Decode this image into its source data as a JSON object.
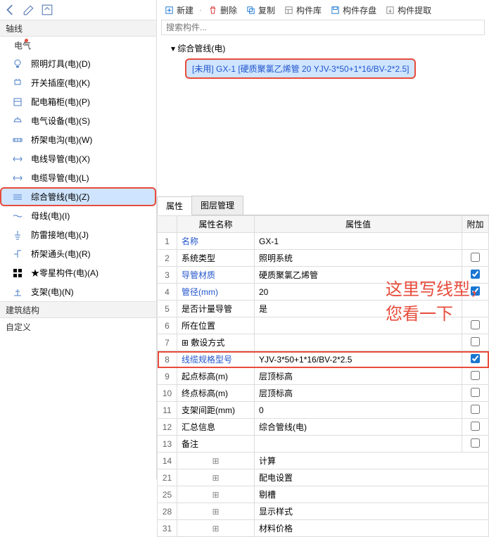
{
  "left": {
    "hdr1": "轴线",
    "cat": "电气",
    "items": [
      {
        "ic": "bulb",
        "t": "照明灯具(电)(D)"
      },
      {
        "ic": "plug",
        "t": "开关插座(电)(K)"
      },
      {
        "ic": "box",
        "t": "配电箱柜(电)(P)"
      },
      {
        "ic": "dev",
        "t": "电气设备(电)(S)"
      },
      {
        "ic": "tray",
        "t": "桥架电沟(电)(W)"
      },
      {
        "ic": "pipe",
        "t": "电线导管(电)(X)"
      },
      {
        "ic": "pipe",
        "t": "电缆导管(电)(L)"
      },
      {
        "ic": "net",
        "t": "综合管线(电)(Z)",
        "sel": true
      },
      {
        "ic": "bus",
        "t": "母线(电)(I)"
      },
      {
        "ic": "gnd",
        "t": "防雷接地(电)(J)"
      },
      {
        "ic": "el",
        "t": "桥架通头(电)(R)"
      },
      {
        "ic": "star",
        "t": "★零星构件(电)(A)"
      },
      {
        "ic": "sup",
        "t": "支架(电)(N)"
      }
    ],
    "hdr2": "建筑结构",
    "hdr3": "自定义"
  },
  "tb": [
    {
      "ic": "new",
      "t": "新建",
      "c": "#1976d2"
    },
    {
      "sep": "·"
    },
    {
      "ic": "del",
      "t": "删除",
      "c": "#d32f2f"
    },
    {
      "ic": "copy",
      "t": "复制",
      "c": "#1976d2"
    },
    {
      "ic": "lib",
      "t": "构件库",
      "c": "#888"
    },
    {
      "ic": "save",
      "t": "构件存盘",
      "c": "#1976d2"
    },
    {
      "ic": "ext",
      "t": "构件提取",
      "c": "#888"
    }
  ],
  "search": "搜索构件...",
  "tree": {
    "root": "综合管线(电)",
    "child": "[未用] GX-1 [硬质聚氯乙烯管 20 YJV-3*50+1*16/BV-2*2.5]"
  },
  "tabs": [
    "属性",
    "图层管理"
  ],
  "cols": [
    "",
    "属性名称",
    "属性值",
    "附加"
  ],
  "rows": [
    {
      "n": "1",
      "name": "名称",
      "link": 1,
      "val": "GX-1"
    },
    {
      "n": "2",
      "name": "系统类型",
      "val": "照明系统",
      "chk": 0
    },
    {
      "n": "3",
      "name": "导管材质",
      "link": 1,
      "val": "硬质聚氯乙烯管",
      "chk": 1
    },
    {
      "n": "4",
      "name": "管径(mm)",
      "link": 1,
      "val": "20",
      "chk": 1
    },
    {
      "n": "5",
      "name": "是否计量导管",
      "val": "是"
    },
    {
      "n": "6",
      "name": "所在位置",
      "val": "",
      "chk": 0
    },
    {
      "n": "7",
      "name": "敷设方式",
      "val": "",
      "chk": 0,
      "exp": "+"
    },
    {
      "n": "8",
      "name": "线缆规格型号",
      "link": 1,
      "val": "YJV-3*50+1*16/BV-2*2.5",
      "chk": 1,
      "red": 1
    },
    {
      "n": "9",
      "name": "起点标高(m)",
      "val": "层顶标高",
      "chk": 0
    },
    {
      "n": "10",
      "name": "终点标高(m)",
      "val": "层顶标高",
      "chk": 0
    },
    {
      "n": "11",
      "name": "支架间距(mm)",
      "val": "0",
      "chk": 0
    },
    {
      "n": "12",
      "name": "汇总信息",
      "val": "综合管线(电)",
      "chk": 0
    },
    {
      "n": "13",
      "name": "备注",
      "val": "",
      "chk": 0
    },
    {
      "n": "14",
      "name": "计算",
      "exp": "+"
    },
    {
      "n": "21",
      "name": "配电设置",
      "exp": "+"
    },
    {
      "n": "25",
      "name": "剔槽",
      "exp": "+"
    },
    {
      "n": "28",
      "name": "显示样式",
      "exp": "+"
    },
    {
      "n": "31",
      "name": "材料价格",
      "exp": "+"
    }
  ],
  "annot": "这里写线型，您看一下"
}
